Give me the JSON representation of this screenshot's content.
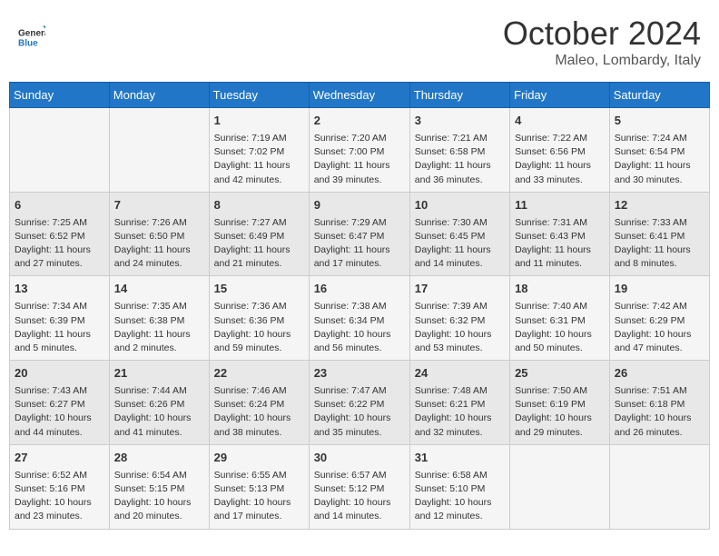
{
  "header": {
    "logo_general": "General",
    "logo_blue": "Blue",
    "month": "October 2024",
    "location": "Maleo, Lombardy, Italy"
  },
  "weekdays": [
    "Sunday",
    "Monday",
    "Tuesday",
    "Wednesday",
    "Thursday",
    "Friday",
    "Saturday"
  ],
  "weeks": [
    [
      {
        "day": "",
        "sunrise": "",
        "sunset": "",
        "daylight": ""
      },
      {
        "day": "",
        "sunrise": "",
        "sunset": "",
        "daylight": ""
      },
      {
        "day": "1",
        "sunrise": "Sunrise: 7:19 AM",
        "sunset": "Sunset: 7:02 PM",
        "daylight": "Daylight: 11 hours and 42 minutes."
      },
      {
        "day": "2",
        "sunrise": "Sunrise: 7:20 AM",
        "sunset": "Sunset: 7:00 PM",
        "daylight": "Daylight: 11 hours and 39 minutes."
      },
      {
        "day": "3",
        "sunrise": "Sunrise: 7:21 AM",
        "sunset": "Sunset: 6:58 PM",
        "daylight": "Daylight: 11 hours and 36 minutes."
      },
      {
        "day": "4",
        "sunrise": "Sunrise: 7:22 AM",
        "sunset": "Sunset: 6:56 PM",
        "daylight": "Daylight: 11 hours and 33 minutes."
      },
      {
        "day": "5",
        "sunrise": "Sunrise: 7:24 AM",
        "sunset": "Sunset: 6:54 PM",
        "daylight": "Daylight: 11 hours and 30 minutes."
      }
    ],
    [
      {
        "day": "6",
        "sunrise": "Sunrise: 7:25 AM",
        "sunset": "Sunset: 6:52 PM",
        "daylight": "Daylight: 11 hours and 27 minutes."
      },
      {
        "day": "7",
        "sunrise": "Sunrise: 7:26 AM",
        "sunset": "Sunset: 6:50 PM",
        "daylight": "Daylight: 11 hours and 24 minutes."
      },
      {
        "day": "8",
        "sunrise": "Sunrise: 7:27 AM",
        "sunset": "Sunset: 6:49 PM",
        "daylight": "Daylight: 11 hours and 21 minutes."
      },
      {
        "day": "9",
        "sunrise": "Sunrise: 7:29 AM",
        "sunset": "Sunset: 6:47 PM",
        "daylight": "Daylight: 11 hours and 17 minutes."
      },
      {
        "day": "10",
        "sunrise": "Sunrise: 7:30 AM",
        "sunset": "Sunset: 6:45 PM",
        "daylight": "Daylight: 11 hours and 14 minutes."
      },
      {
        "day": "11",
        "sunrise": "Sunrise: 7:31 AM",
        "sunset": "Sunset: 6:43 PM",
        "daylight": "Daylight: 11 hours and 11 minutes."
      },
      {
        "day": "12",
        "sunrise": "Sunrise: 7:33 AM",
        "sunset": "Sunset: 6:41 PM",
        "daylight": "Daylight: 11 hours and 8 minutes."
      }
    ],
    [
      {
        "day": "13",
        "sunrise": "Sunrise: 7:34 AM",
        "sunset": "Sunset: 6:39 PM",
        "daylight": "Daylight: 11 hours and 5 minutes."
      },
      {
        "day": "14",
        "sunrise": "Sunrise: 7:35 AM",
        "sunset": "Sunset: 6:38 PM",
        "daylight": "Daylight: 11 hours and 2 minutes."
      },
      {
        "day": "15",
        "sunrise": "Sunrise: 7:36 AM",
        "sunset": "Sunset: 6:36 PM",
        "daylight": "Daylight: 10 hours and 59 minutes."
      },
      {
        "day": "16",
        "sunrise": "Sunrise: 7:38 AM",
        "sunset": "Sunset: 6:34 PM",
        "daylight": "Daylight: 10 hours and 56 minutes."
      },
      {
        "day": "17",
        "sunrise": "Sunrise: 7:39 AM",
        "sunset": "Sunset: 6:32 PM",
        "daylight": "Daylight: 10 hours and 53 minutes."
      },
      {
        "day": "18",
        "sunrise": "Sunrise: 7:40 AM",
        "sunset": "Sunset: 6:31 PM",
        "daylight": "Daylight: 10 hours and 50 minutes."
      },
      {
        "day": "19",
        "sunrise": "Sunrise: 7:42 AM",
        "sunset": "Sunset: 6:29 PM",
        "daylight": "Daylight: 10 hours and 47 minutes."
      }
    ],
    [
      {
        "day": "20",
        "sunrise": "Sunrise: 7:43 AM",
        "sunset": "Sunset: 6:27 PM",
        "daylight": "Daylight: 10 hours and 44 minutes."
      },
      {
        "day": "21",
        "sunrise": "Sunrise: 7:44 AM",
        "sunset": "Sunset: 6:26 PM",
        "daylight": "Daylight: 10 hours and 41 minutes."
      },
      {
        "day": "22",
        "sunrise": "Sunrise: 7:46 AM",
        "sunset": "Sunset: 6:24 PM",
        "daylight": "Daylight: 10 hours and 38 minutes."
      },
      {
        "day": "23",
        "sunrise": "Sunrise: 7:47 AM",
        "sunset": "Sunset: 6:22 PM",
        "daylight": "Daylight: 10 hours and 35 minutes."
      },
      {
        "day": "24",
        "sunrise": "Sunrise: 7:48 AM",
        "sunset": "Sunset: 6:21 PM",
        "daylight": "Daylight: 10 hours and 32 minutes."
      },
      {
        "day": "25",
        "sunrise": "Sunrise: 7:50 AM",
        "sunset": "Sunset: 6:19 PM",
        "daylight": "Daylight: 10 hours and 29 minutes."
      },
      {
        "day": "26",
        "sunrise": "Sunrise: 7:51 AM",
        "sunset": "Sunset: 6:18 PM",
        "daylight": "Daylight: 10 hours and 26 minutes."
      }
    ],
    [
      {
        "day": "27",
        "sunrise": "Sunrise: 6:52 AM",
        "sunset": "Sunset: 5:16 PM",
        "daylight": "Daylight: 10 hours and 23 minutes."
      },
      {
        "day": "28",
        "sunrise": "Sunrise: 6:54 AM",
        "sunset": "Sunset: 5:15 PM",
        "daylight": "Daylight: 10 hours and 20 minutes."
      },
      {
        "day": "29",
        "sunrise": "Sunrise: 6:55 AM",
        "sunset": "Sunset: 5:13 PM",
        "daylight": "Daylight: 10 hours and 17 minutes."
      },
      {
        "day": "30",
        "sunrise": "Sunrise: 6:57 AM",
        "sunset": "Sunset: 5:12 PM",
        "daylight": "Daylight: 10 hours and 14 minutes."
      },
      {
        "day": "31",
        "sunrise": "Sunrise: 6:58 AM",
        "sunset": "Sunset: 5:10 PM",
        "daylight": "Daylight: 10 hours and 12 minutes."
      },
      {
        "day": "",
        "sunrise": "",
        "sunset": "",
        "daylight": ""
      },
      {
        "day": "",
        "sunrise": "",
        "sunset": "",
        "daylight": ""
      }
    ]
  ]
}
